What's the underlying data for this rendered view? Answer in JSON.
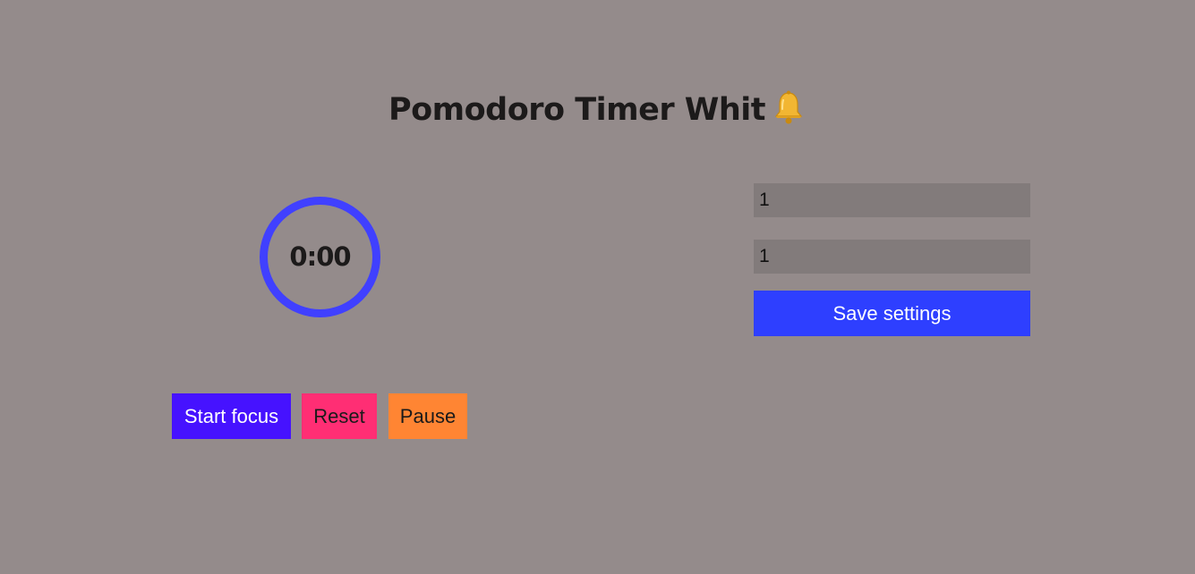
{
  "header": {
    "title": "Pomodoro Timer Whit",
    "title_icon": "bell-icon"
  },
  "timer": {
    "display": "0:00",
    "ring_color": "#4040ff"
  },
  "controls": {
    "start_label": "Start focus",
    "reset_label": "Reset",
    "pause_label": "Pause"
  },
  "settings": {
    "focus_minutes": "1",
    "break_minutes": "1",
    "save_label": "Save settings"
  },
  "colors": {
    "background": "#948b8b",
    "start": "#4612ff",
    "reset": "#ff2e74",
    "pause": "#ff8533",
    "save": "#2e3fff",
    "input_bg": "#827b7b"
  }
}
